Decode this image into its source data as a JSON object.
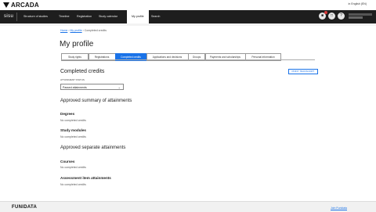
{
  "brand": {
    "logo_text": "ARCADA",
    "app_name": "sisu",
    "footer_brand": "FUNIDATA"
  },
  "lang": "in English (EN)",
  "nav": [
    {
      "label": "Structure of studies"
    },
    {
      "label": "Timeline"
    },
    {
      "label": "Registration"
    },
    {
      "label": "Study calendar"
    },
    {
      "label": "My profile"
    },
    {
      "label": "Search"
    }
  ],
  "breadcrumb": {
    "home": "Home",
    "profile": "My profile",
    "current": "Completed credits"
  },
  "page_title": "My profile",
  "tabs": [
    {
      "label": "Study rights"
    },
    {
      "label": "Registrations"
    },
    {
      "label": "Completed credits"
    },
    {
      "label": "Applications and decisions"
    },
    {
      "label": "Groups"
    },
    {
      "label": "Payments and scholarships"
    },
    {
      "label": "Personal information"
    }
  ],
  "completed": {
    "heading": "Completed credits",
    "print_label": "PRINT TRANSCRIPT",
    "select_label": "ATTAINMENT STATUS",
    "select_value": "Passed attainments"
  },
  "approved_summary": {
    "heading": "Approved summary of attainments",
    "degrees": "Degrees",
    "degrees_empty": "No completed credits",
    "modules": "Study modules",
    "modules_empty": "No completed credits"
  },
  "approved_separate": {
    "heading": "Approved separate attainments",
    "courses": "Courses",
    "courses_empty": "No completed credits",
    "items": "Assessment item attainments",
    "items_empty": "No completed credits"
  },
  "footer": {
    "feedback": "Join Funidata"
  },
  "icons": {
    "notifications": "bell-icon",
    "messages": "inbox-icon",
    "help": "help-icon",
    "select": "chevron-down-icon"
  }
}
